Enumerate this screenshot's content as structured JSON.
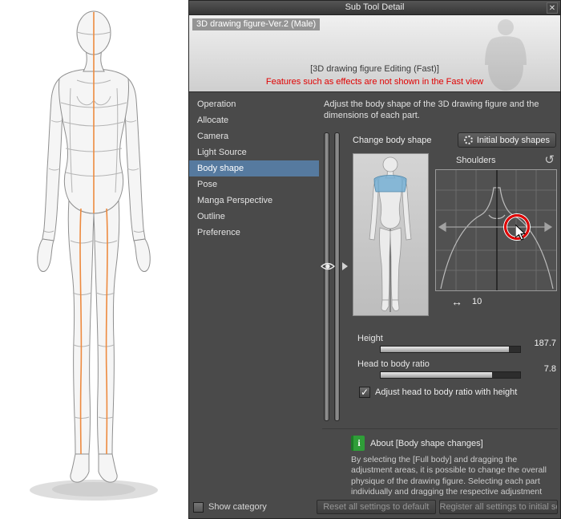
{
  "window": {
    "title": "Sub Tool Detail",
    "close_icon": "✕"
  },
  "preview": {
    "tool_label": "3D drawing figure-Ver.2 (Male)",
    "mode_label": "[3D drawing figure Editing (Fast)]",
    "warning": "Features such as effects are not shown in the Fast view"
  },
  "categories": {
    "selected": "Body shape",
    "items": [
      {
        "label": "Operation"
      },
      {
        "label": "Allocate"
      },
      {
        "label": "Camera"
      },
      {
        "label": "Light Source"
      },
      {
        "label": "Body shape"
      },
      {
        "label": "Pose"
      },
      {
        "label": "Manga Perspective"
      },
      {
        "label": "Outline"
      },
      {
        "label": "Preference"
      }
    ]
  },
  "body_shape": {
    "description": "Adjust the body shape of the 3D drawing figure and the dimensions of each part.",
    "change_body_shape_label": "Change body shape",
    "initial_body_shapes_button": "Initial body shapes",
    "part_label": "Shoulders",
    "reset_icon": "↺",
    "width_arrow_icon": "↔",
    "width_value": "10",
    "height_label": "Height",
    "height_value": "187.7",
    "ratio_label": "Head to body ratio",
    "ratio_value": "7.8",
    "ratio_checkbox_label": "Adjust head to body ratio with height",
    "checkbox_check_icon": "✓"
  },
  "about": {
    "icon_letter": "i",
    "title": "About [Body shape changes]",
    "body": "By selecting the [Full body] and dragging the adjustment areas, it is possible to change the overall physique of the drawing figure. Selecting each part individually and dragging the respective adjustment area, allows to change the width and length of diffe"
  },
  "footer": {
    "show_category_label": "Show category",
    "reset_all_button": "Reset all settings to default",
    "register_all_button": "Register all settings to initial settings"
  },
  "colors": {
    "panel_bg": "#4a4a4a",
    "selection_blue": "#567a9f",
    "warning_red": "#e10000",
    "shoulder_highlight_blue": "#74aed2",
    "center_line_orange": "#ed8a3f",
    "info_green": "#2f9e38"
  }
}
